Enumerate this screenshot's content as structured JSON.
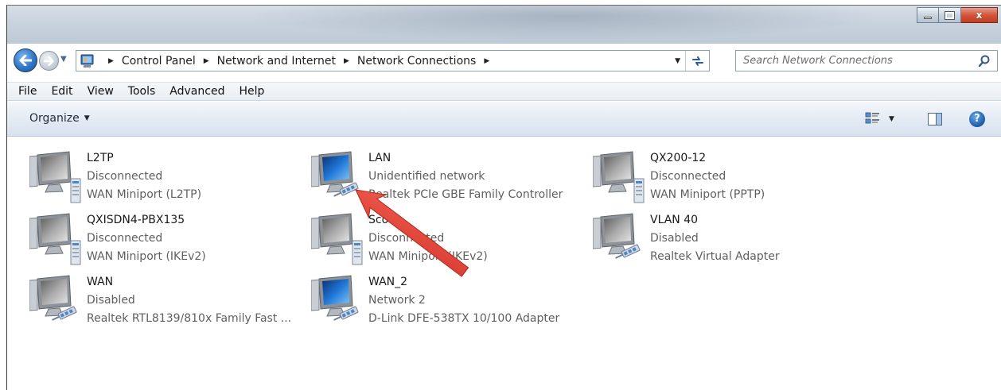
{
  "window": {
    "caption_buttons": {
      "minimize": "minimize",
      "maximize": "maximize",
      "close": "x"
    }
  },
  "nav": {
    "breadcrumbs": [
      "Control Panel",
      "Network and Internet",
      "Network Connections"
    ],
    "search_placeholder": "Search Network Connections"
  },
  "menu": {
    "items": [
      "File",
      "Edit",
      "View",
      "Tools",
      "Advanced",
      "Help"
    ]
  },
  "toolbar": {
    "organize_label": "Organize"
  },
  "connections": [
    {
      "name": "L2TP",
      "status": "Disconnected",
      "device": "WAN Miniport (L2TP)",
      "icon": "monitor-gray-with-server-icon"
    },
    {
      "name": "LAN",
      "status": "Unidentified network",
      "device": "Realtek PCIe GBE Family Controller",
      "icon": "monitor-blue-with-cable-icon"
    },
    {
      "name": "QX200-12",
      "status": "Disconnected",
      "device": "WAN Miniport (PPTP)",
      "icon": "monitor-gray-with-server-icon"
    },
    {
      "name": "QXISDN4-PBX135",
      "status": "Disconnected",
      "device": "WAN Miniport (IKEv2)",
      "icon": "monitor-gray-with-server-icon"
    },
    {
      "name": "Scott",
      "status": "Disconnected",
      "device": "WAN Miniport (IKEv2)",
      "icon": "monitor-gray-with-server-icon"
    },
    {
      "name": "VLAN 40",
      "status": "Disabled",
      "device": "Realtek Virtual Adapter",
      "icon": "monitor-gray-with-cable-icon"
    },
    {
      "name": "WAN",
      "status": "Disabled",
      "device": "Realtek RTL8139/810x Family Fast ...",
      "icon": "monitor-gray-with-cable-icon"
    },
    {
      "name": "WAN_2",
      "status": "Network  2",
      "device": "D-Link DFE-538TX 10/100 Adapter",
      "icon": "monitor-blue-with-cable-icon"
    }
  ],
  "annotation": {
    "arrow_color": "#e0443a"
  },
  "colors": {
    "accent_blue": "#2f77c6",
    "arrow_red": "#e0443a"
  }
}
